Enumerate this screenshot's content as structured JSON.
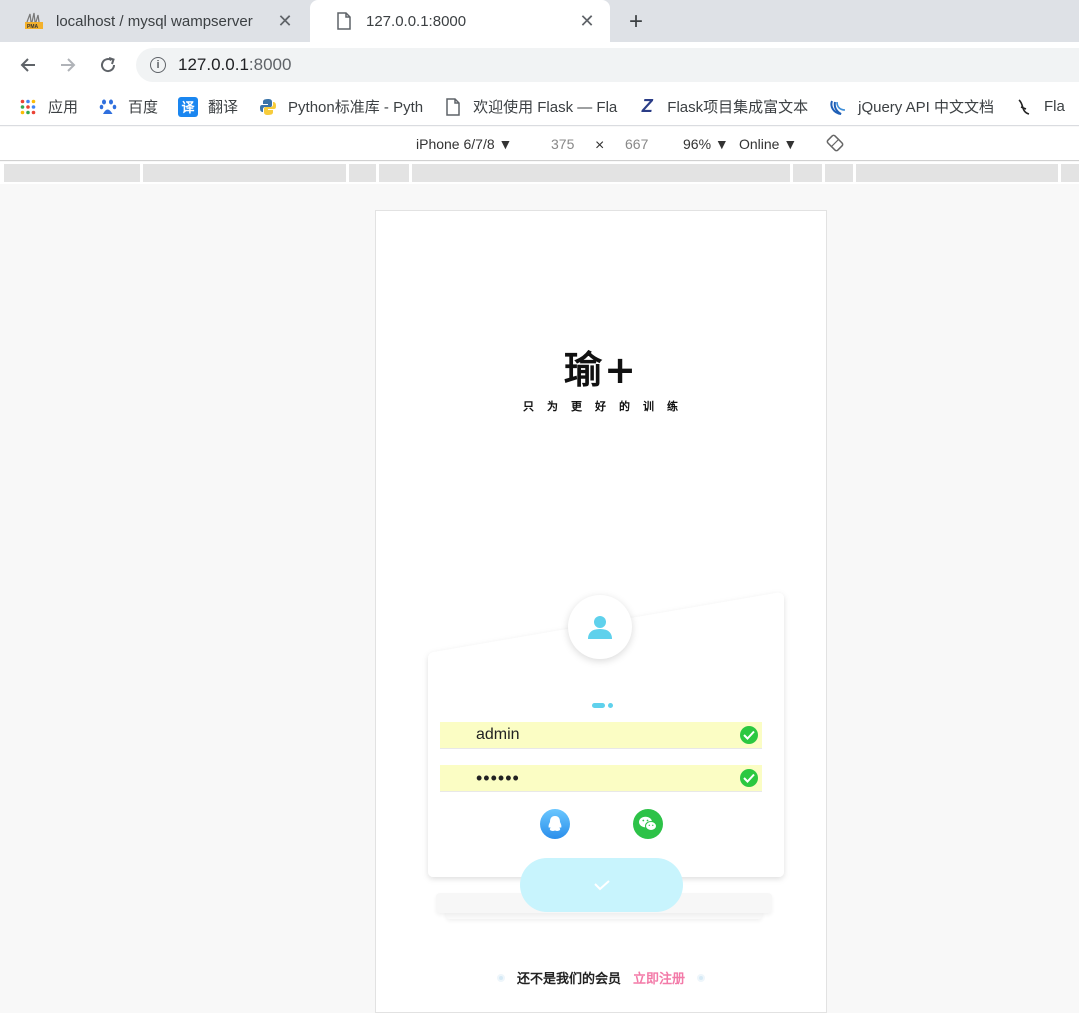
{
  "tabs": [
    {
      "title": "localhost / mysql wampserver",
      "favicon": "phpmyadmin-icon",
      "active": false
    },
    {
      "title": "127.0.0.1:8000",
      "favicon": "page-icon",
      "active": true
    }
  ],
  "toolbar": {
    "url_host": "127.0.0.1",
    "url_port": ":8000"
  },
  "bookmarks": [
    {
      "label": "应用",
      "icon": "apps-grid-icon"
    },
    {
      "label": "百度",
      "icon": "baidu-paw-icon"
    },
    {
      "label": "翻译",
      "icon": "translate-icon",
      "icon_text": "译"
    },
    {
      "label": "Python标准库 - Pyth",
      "icon": "python-icon"
    },
    {
      "label": "欢迎使用 Flask — Fla",
      "icon": "page-icon"
    },
    {
      "label": "Flask项目集成富文本",
      "icon": "zblog-icon",
      "icon_text": "Z"
    },
    {
      "label": "jQuery API 中文文档",
      "icon": "jquery-icon"
    },
    {
      "label": "Fla",
      "icon": "flask-icon"
    }
  ],
  "device_toolbar": {
    "device": "iPhone 6/7/8 ▼",
    "width": "375",
    "times": "×",
    "height": "667",
    "zoom": "96% ▼",
    "network": "Online ▼"
  },
  "app": {
    "brand": "瑜+",
    "slogan": "只为更好的训练",
    "username_value": "admin",
    "password_value": "••••••",
    "footer_text": "还不是我们的会员",
    "register_link": "立即注册",
    "accent": "#5fd1ec",
    "autofill_bg": "#fbfdc4",
    "register_color": "#f37aa8"
  }
}
